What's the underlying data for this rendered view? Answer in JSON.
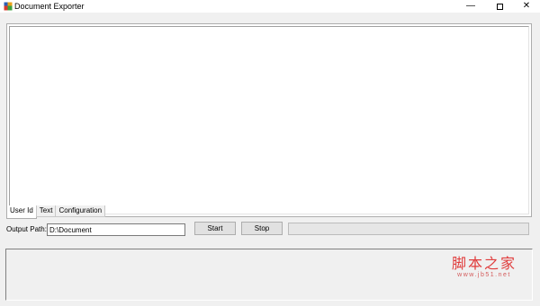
{
  "window": {
    "title": "Document Exporter",
    "icons": {
      "app": "document-exporter-app-icon",
      "minimize": "minimize-icon",
      "maximize": "maximize-icon",
      "close": "close-icon"
    },
    "minimize_glyph": "—",
    "close_glyph": "✕"
  },
  "main": {
    "text_area_value": "",
    "tabs": [
      {
        "label": "User Id",
        "active": true
      },
      {
        "label": "Text",
        "active": false
      },
      {
        "label": "Configuration",
        "active": false
      }
    ]
  },
  "output": {
    "label": "Output Path:",
    "path_value": "D:\\Document"
  },
  "buttons": {
    "start": "Start",
    "stop": "Stop"
  },
  "progress": {
    "fraction": 0,
    "fill_color": "#06b025"
  },
  "log": {
    "content": ""
  },
  "watermark": {
    "main": "脚本之家",
    "sub": "www.jb51.net"
  }
}
